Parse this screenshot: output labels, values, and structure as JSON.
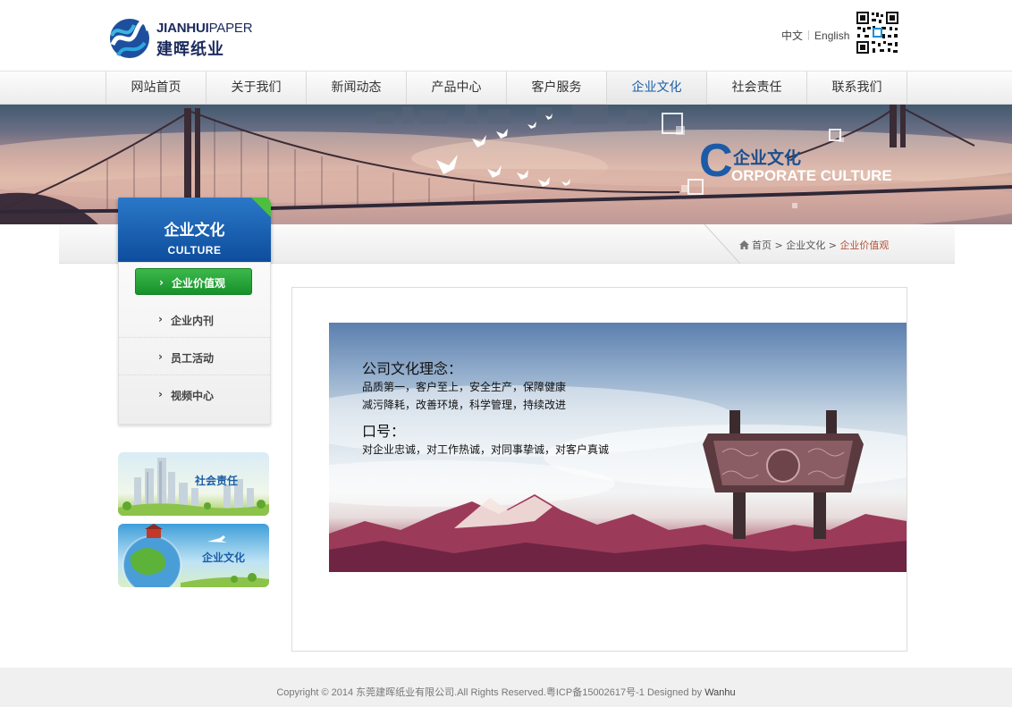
{
  "header": {
    "logo_en_bold": "JIANHUI",
    "logo_en_light": "PAPER",
    "logo_cn": "建晖纸业",
    "lang_cn": "中文",
    "lang_en": "English",
    "qr_icon": "qr-code-icon"
  },
  "nav": {
    "items": [
      {
        "label": "网站首页"
      },
      {
        "label": "关于我们"
      },
      {
        "label": "新闻动态"
      },
      {
        "label": "产品中心"
      },
      {
        "label": "客户服务"
      },
      {
        "label": "企业文化"
      },
      {
        "label": "社会责任"
      },
      {
        "label": "联系我们"
      }
    ],
    "active_index": 5
  },
  "banner": {
    "c_letter": "C",
    "title_cn": "企业文化",
    "title_en": "ORPORATE CULTURE"
  },
  "breadcrumb": {
    "home": "首页",
    "sep": ">",
    "level1": "企业文化",
    "current": "企业价值观"
  },
  "sidebar": {
    "title_cn": "企业文化",
    "title_en": "CULTURE",
    "items": [
      {
        "label": "企业价值观",
        "active": true
      },
      {
        "label": "企业内刊"
      },
      {
        "label": "员工活动"
      },
      {
        "label": "视频中心"
      }
    ],
    "promos": [
      {
        "label": "社会责任"
      },
      {
        "label": "企业文化"
      }
    ]
  },
  "content": {
    "heading1": "公司文化理念：",
    "line1": "品质第一，客户至上，安全生产，保障健康",
    "line2": "减污降耗，改善环境，科学管理，持续改进",
    "heading2": "口号：",
    "line3": "对企业忠诚，对工作热诚，对同事挚诚，对客户真诚"
  },
  "footer": {
    "text": "Copyright © 2014 东莞建晖纸业有限公司.All Rights Reserved.粤ICP备15002617号-1 Designed by ",
    "brand": "Wanhu"
  },
  "colors": {
    "brand_blue": "#1a5ea8",
    "active_green": "#2aa63b",
    "breadcrumb_current": "#b5533a"
  }
}
